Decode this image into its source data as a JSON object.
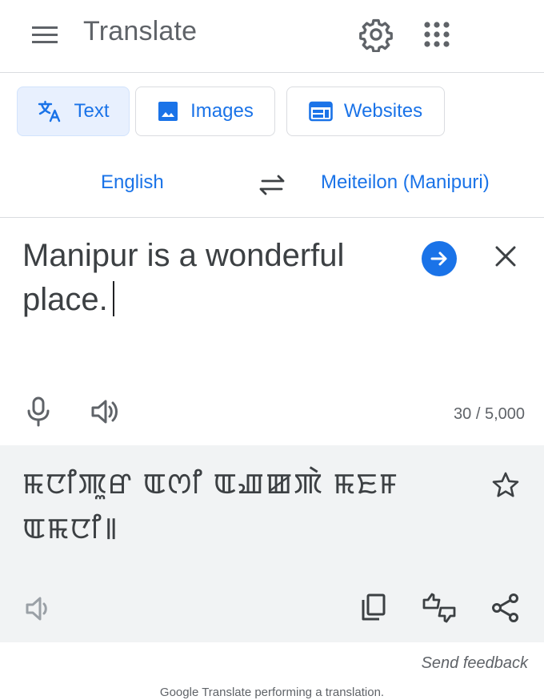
{
  "header": {
    "title": "Translate",
    "icons": {
      "menu": "menu-icon",
      "settings": "gear-icon",
      "apps": "apps-grid-icon"
    }
  },
  "tabs": [
    {
      "label": "Text",
      "icon": "translate-icon",
      "active": true
    },
    {
      "label": "Images",
      "icon": "image-icon",
      "active": false
    },
    {
      "label": "Websites",
      "icon": "web-icon",
      "active": false
    }
  ],
  "languages": {
    "source": "English",
    "target": "Meiteilon (Manipuri)",
    "swap_icon": "swap-arrows-icon"
  },
  "input": {
    "text": "Manipur is a wonderful place.",
    "char_count": "30 / 5,000"
  },
  "output": {
    "text": "ꯃꯅꯤꯄꯨꯔ ꯑꯁꯤ ꯑꯉꯀꯄꯥ ꯃꯐꯝ ꯑꯃꯅꯤ꯫"
  },
  "footer": {
    "send_feedback": "Send feedback",
    "status": "Google Translate performing a translation."
  },
  "colors": {
    "accent": "#1a73e8",
    "active_tab_bg": "#e8f0fe",
    "output_bg": "#f1f3f4",
    "icon_gray": "#5f6368",
    "disabled_gray": "#9aa0a6"
  }
}
